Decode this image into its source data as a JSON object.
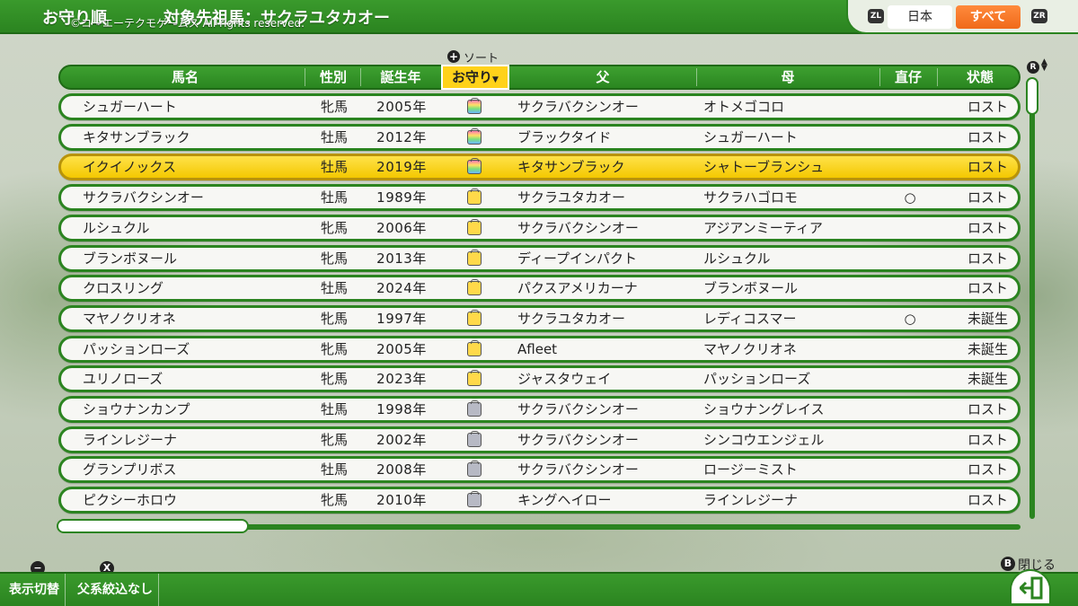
{
  "header": {
    "title": "お守り順",
    "target": "対象先祖馬：サクラユタカオー",
    "copyright": "©コーエーテクモゲームス All rights reserved.",
    "zl": "ZL",
    "zr": "ZR",
    "region_japan": "日本",
    "region_all": "すべて"
  },
  "sort": {
    "label": "ソート",
    "plus": "+"
  },
  "columns": {
    "name": "馬名",
    "sex": "性別",
    "year": "誕生年",
    "amulet": "お守り",
    "amulet_caret": "▼",
    "sire": "父",
    "dam": "母",
    "direct": "直仔",
    "status": "状態"
  },
  "rows": [
    {
      "name": "シュガーハート",
      "sex": "牝馬",
      "year": "2005年",
      "amulet": "rainbow",
      "sire": "サクラバクシンオー",
      "dam": "オトメゴコロ",
      "direct": "",
      "status": "ロスト"
    },
    {
      "name": "キタサンブラック",
      "sex": "牡馬",
      "year": "2012年",
      "amulet": "rainbow",
      "sire": "ブラックタイド",
      "dam": "シュガーハート",
      "direct": "",
      "status": "ロスト"
    },
    {
      "name": "イクイノックス",
      "sex": "牡馬",
      "year": "2019年",
      "amulet": "rainbow",
      "sire": "キタサンブラック",
      "dam": "シャトーブランシュ",
      "direct": "",
      "status": "ロスト"
    },
    {
      "name": "サクラバクシンオー",
      "sex": "牡馬",
      "year": "1989年",
      "amulet": "gold",
      "sire": "サクラユタカオー",
      "dam": "サクラハゴロモ",
      "direct": "○",
      "status": "ロスト"
    },
    {
      "name": "ルシュクル",
      "sex": "牝馬",
      "year": "2006年",
      "amulet": "gold",
      "sire": "サクラバクシンオー",
      "dam": "アジアンミーティア",
      "direct": "",
      "status": "ロスト"
    },
    {
      "name": "ブランボヌール",
      "sex": "牝馬",
      "year": "2013年",
      "amulet": "gold",
      "sire": "ディープインパクト",
      "dam": "ルシュクル",
      "direct": "",
      "status": "ロスト"
    },
    {
      "name": "クロスリング",
      "sex": "牡馬",
      "year": "2024年",
      "amulet": "gold",
      "sire": "パクスアメリカーナ",
      "dam": "ブランボヌール",
      "direct": "",
      "status": "ロスト"
    },
    {
      "name": "マヤノクリオネ",
      "sex": "牝馬",
      "year": "1997年",
      "amulet": "gold",
      "sire": "サクラユタカオー",
      "dam": "レディコスマー",
      "direct": "○",
      "status": "未誕生"
    },
    {
      "name": "パッションローズ",
      "sex": "牝馬",
      "year": "2005年",
      "amulet": "gold",
      "sire": "Afleet",
      "dam": "マヤノクリオネ",
      "direct": "",
      "status": "未誕生"
    },
    {
      "name": "ユリノローズ",
      "sex": "牝馬",
      "year": "2023年",
      "amulet": "gold",
      "sire": "ジャスタウェイ",
      "dam": "パッションローズ",
      "direct": "",
      "status": "未誕生"
    },
    {
      "name": "ショウナンカンプ",
      "sex": "牡馬",
      "year": "1998年",
      "amulet": "silver",
      "sire": "サクラバクシンオー",
      "dam": "ショウナングレイス",
      "direct": "",
      "status": "ロスト"
    },
    {
      "name": "ラインレジーナ",
      "sex": "牝馬",
      "year": "2002年",
      "amulet": "silver",
      "sire": "サクラバクシンオー",
      "dam": "シンコウエンジェル",
      "direct": "",
      "status": "ロスト"
    },
    {
      "name": "グランプリボス",
      "sex": "牡馬",
      "year": "2008年",
      "amulet": "silver",
      "sire": "サクラバクシンオー",
      "dam": "ロージーミスト",
      "direct": "",
      "status": "ロスト"
    },
    {
      "name": "ピクシーホロウ",
      "sex": "牝馬",
      "year": "2010年",
      "amulet": "silver",
      "sire": "キングヘイロー",
      "dam": "ラインレジーナ",
      "direct": "",
      "status": "ロスト"
    }
  ],
  "selected_row": 2,
  "scroll": {
    "r_label": "R"
  },
  "footer": {
    "toggle_label": "表示切替",
    "toggle_key": "−",
    "filter_label": "父系絞込なし",
    "filter_key": "X",
    "close_label": "閉じる",
    "close_key": "B"
  },
  "colors": {
    "accent": "#2b8420",
    "highlight": "#ffd21a",
    "tab_active": "#f06a1a"
  }
}
